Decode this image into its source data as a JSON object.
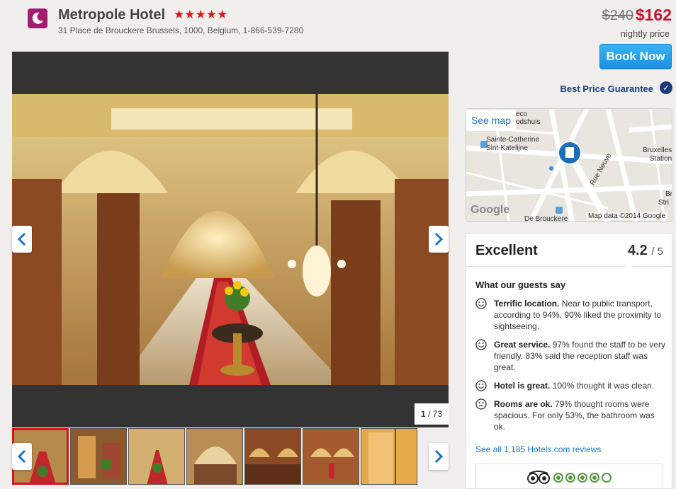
{
  "header": {
    "hotel_name": "Metropole Hotel",
    "stars": "★★★★★",
    "star_rating": 5,
    "address": "31 Place de Brouckere Brussels, 1000, Belgium, 1-866-539-7280"
  },
  "pricing": {
    "old_price": "$240",
    "new_price": "$162",
    "note": "nightly price",
    "book_label": "Book Now",
    "guarantee": "Best Price Guarantee"
  },
  "gallery": {
    "counter_current": "1",
    "counter_total": "/ 73"
  },
  "map": {
    "see_map": "See map",
    "credit": "Map data ©2014 Google",
    "labels": {
      "a": "eco",
      "b": "odshuis",
      "c": "Sainte-Catherine",
      "d": "Sint-Katelijne",
      "e": "Bruxelles",
      "f": "Station",
      "g": "Rue Neuve",
      "h": "De Brouckere",
      "i": "Google",
      "j": "Br",
      "k": "Stri"
    }
  },
  "reviews": {
    "rating_word": "Excellent",
    "score": "4.2",
    "score_max": "/ 5",
    "title": "What our guests say",
    "items": [
      {
        "bold": "Terrific location.",
        "text": " Near to public transport, according to 94%. 90% liked the proximity to sightseeing.",
        "mood": "happy"
      },
      {
        "bold": "Great service.",
        "text": " 97% found the staff to be very friendly. 83% said the reception staff was great.",
        "mood": "happy"
      },
      {
        "bold": "Hotel is great.",
        "text": " 100% thought it was clean.",
        "mood": "happy"
      },
      {
        "bold": "Rooms are ok.",
        "text": " 79% thought rooms were spacious. For only 53%, the bathroom was ok.",
        "mood": "neutral"
      }
    ],
    "see_all": "See all 1,185 Hotels.com reviews",
    "tripadvisor_bubbles": 4
  },
  "colors": {
    "price_red": "#c41230",
    "star_red": "#e4151f",
    "link_blue": "#1a73c8",
    "brand_purple": "#a21c72",
    "book_blue": "#1b8fe0",
    "tripadvisor_green": "#589442"
  }
}
